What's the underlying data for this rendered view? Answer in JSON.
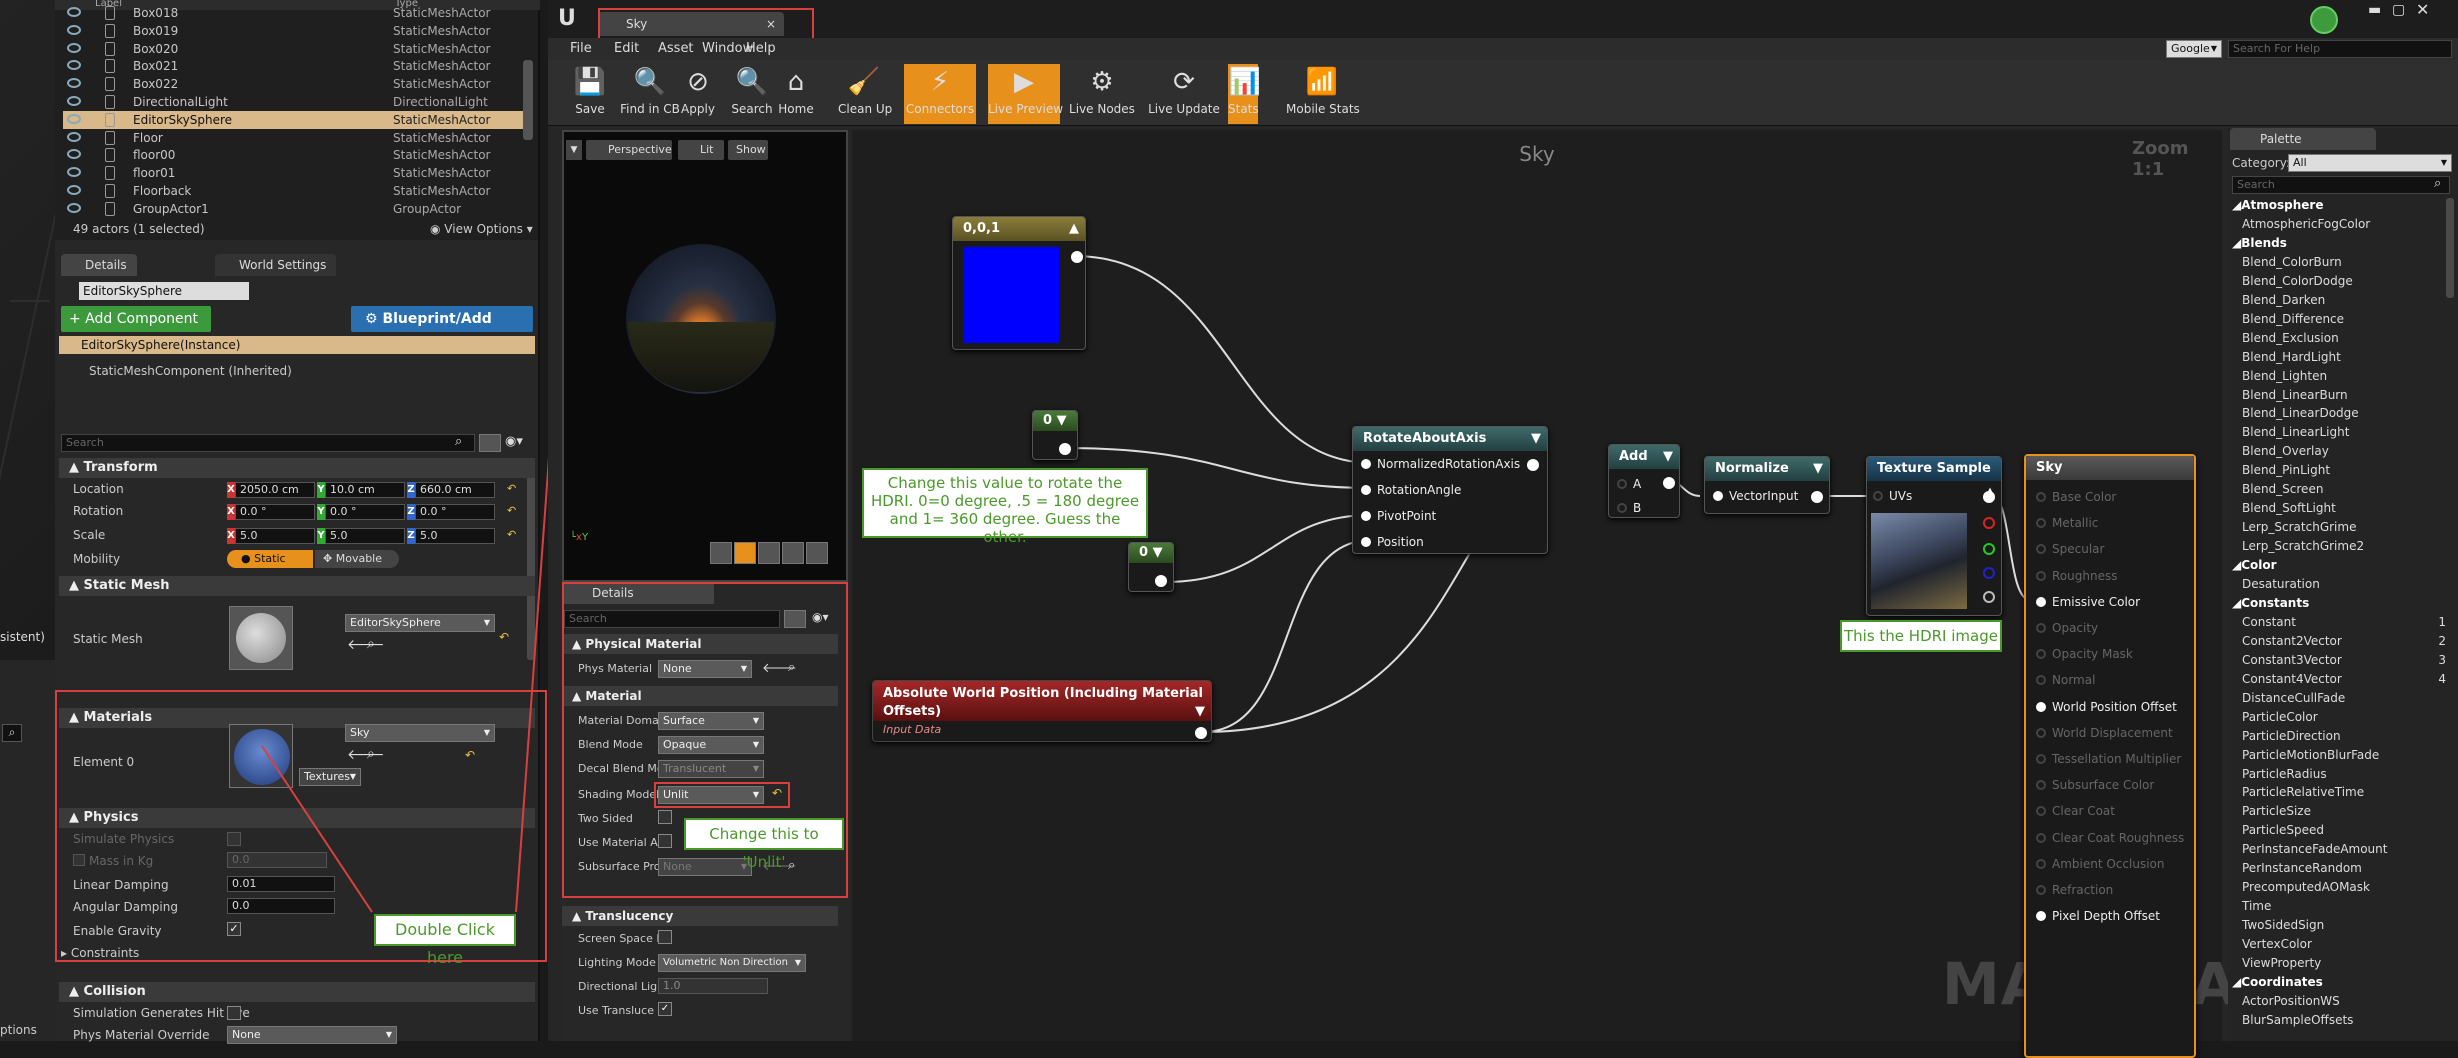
{
  "outliner": {
    "header": {
      "label": "Label",
      "type": "Type"
    },
    "rows": [
      {
        "name": "Box018",
        "type": "StaticMeshActor"
      },
      {
        "name": "Box019",
        "type": "StaticMeshActor"
      },
      {
        "name": "Box020",
        "type": "StaticMeshActor"
      },
      {
        "name": "Box021",
        "type": "StaticMeshActor"
      },
      {
        "name": "Box022",
        "type": "StaticMeshActor"
      },
      {
        "name": "DirectionalLight",
        "type": "DirectionalLight"
      },
      {
        "name": "EditorSkySphere",
        "type": "StaticMeshActor"
      },
      {
        "name": "Floor",
        "type": "StaticMeshActor"
      },
      {
        "name": "floor00",
        "type": "StaticMeshActor"
      },
      {
        "name": "floor01",
        "type": "StaticMeshActor"
      },
      {
        "name": "Floorback",
        "type": "StaticMeshActor"
      },
      {
        "name": "GroupActor1",
        "type": "GroupActor"
      }
    ],
    "status": "49 actors (1 selected)",
    "view_options": "View Options"
  },
  "details": {
    "tabs": [
      "Details",
      "World Settings"
    ],
    "actor_name": "EditorSkySphere",
    "add_component": "+ Add Component",
    "blueprint": "Blueprint/Add Script",
    "instance": "EditorSkySphere(Instance)",
    "component": "StaticMeshComponent (Inherited)",
    "search_placeholder": "Search",
    "transform": {
      "title": "Transform",
      "location_label": "Location",
      "rotation_label": "Rotation",
      "scale_label": "Scale",
      "mobility_label": "Mobility",
      "location": [
        "2050.0 cm",
        "10.0 cm",
        "660.0 cm"
      ],
      "rotation": [
        "0.0 °",
        "0.0 °",
        "0.0 °"
      ],
      "scale": [
        "5.0",
        "5.0",
        "5.0"
      ],
      "static": "Static",
      "movable": "Movable"
    },
    "static_mesh": {
      "title": "Static Mesh",
      "label": "Static Mesh",
      "value": "EditorSkySphere"
    },
    "materials": {
      "title": "Materials",
      "label": "Element 0",
      "value": "Sky",
      "textures": "Textures"
    },
    "physics": {
      "title": "Physics",
      "simulate": "Simulate Physics",
      "mass": "Mass in Kg",
      "mass_value": "0.0",
      "linear": "Linear Damping",
      "linear_value": "0.01",
      "angular": "Angular Damping",
      "angular_value": "0.0",
      "gravity": "Enable Gravity",
      "constraints": "Constraints"
    },
    "collision": {
      "title": "Collision",
      "sim_hit": "Simulation Generates Hit Eve",
      "phys_override": "Phys Material Override",
      "phys_value": "None"
    },
    "options": "ptions"
  },
  "annotations": {
    "double_click": "Double Click here",
    "unlit": "Change this to 'Unlit'",
    "rotate": "Change this value to rotate the HDRI. 0=0 degree, .5 = 180 degree and 1= 360 degree. Guess the other.",
    "hdri": "This the HDRI image"
  },
  "material_editor": {
    "tab": "Sky",
    "menu": [
      "File",
      "Edit",
      "Asset",
      "Window",
      "Help"
    ],
    "toolbar": [
      "Save",
      "Find in CB",
      "Apply",
      "Search",
      "Home",
      "Clean Up",
      "Connectors",
      "Live Preview",
      "Live Nodes",
      "Live Update",
      "Stats",
      "Mobile Stats"
    ],
    "search_engine": "Google",
    "search_help": "Search For Help",
    "preview": {
      "perspective": "Perspective",
      "lit": "Lit",
      "show": "Show"
    },
    "graph_title": "Sky",
    "zoom": "Zoom 1:1",
    "watermark": "MATERIAL",
    "mat_details": {
      "tab": "Details",
      "search": "Search",
      "phys_section": "Physical Material",
      "phys_label": "Phys Material",
      "phys_value": "None",
      "material_section": "Material",
      "domain_label": "Material Doma",
      "domain_value": "Surface",
      "blend_label": "Blend Mode",
      "blend_value": "Opaque",
      "decal_label": "Decal Blend Mo",
      "decal_value": "Translucent",
      "shading_label": "Shading Model",
      "shading_value": "Unlit",
      "two_sided": "Two Sided",
      "use_material": "Use Material A",
      "subsurface": "Subsurface Pro",
      "subsurface_value": "None",
      "translucency": "Translucency",
      "screen_space": "Screen Space R",
      "lighting_mode": "Lighting Mode",
      "lighting_value": "Volumetric Non Direction",
      "directional": "Directional Ligh",
      "directional_value": "1.0",
      "use_transluc": "Use Transluce"
    }
  },
  "nodes": {
    "const3": {
      "title": "0,0,1",
      "color": "#0000ff"
    },
    "zero1": {
      "title": "0"
    },
    "zero2": {
      "title": "0"
    },
    "rotate": {
      "title": "RotateAboutAxis",
      "pins": [
        "NormalizedRotationAxis",
        "RotationAngle",
        "PivotPoint",
        "Position"
      ]
    },
    "add": {
      "title": "Add",
      "pins": [
        "A",
        "B"
      ]
    },
    "normalize": {
      "title": "Normalize",
      "pins": [
        "VectorInput"
      ]
    },
    "texture": {
      "title": "Texture Sample",
      "pins": [
        "UVs"
      ]
    },
    "awp": {
      "title": "Absolute World Position (Including Material Offsets)",
      "subtitle": "Input Data"
    },
    "sky": {
      "title": "Sky",
      "pins": [
        {
          "label": "Base Color",
          "active": false
        },
        {
          "label": "Metallic",
          "active": false
        },
        {
          "label": "Specular",
          "active": false
        },
        {
          "label": "Roughness",
          "active": false
        },
        {
          "label": "Emissive Color",
          "active": true
        },
        {
          "label": "Opacity",
          "active": false
        },
        {
          "label": "Opacity Mask",
          "active": false
        },
        {
          "label": "Normal",
          "active": false
        },
        {
          "label": "World Position Offset",
          "active": true
        },
        {
          "label": "World Displacement",
          "active": false
        },
        {
          "label": "Tessellation Multiplier",
          "active": false
        },
        {
          "label": "Subsurface Color",
          "active": false
        },
        {
          "label": "Clear Coat",
          "active": false
        },
        {
          "label": "Clear Coat Roughness",
          "active": false
        },
        {
          "label": "Ambient Occlusion",
          "active": false
        },
        {
          "label": "Refraction",
          "active": false
        },
        {
          "label": "Pixel Depth Offset",
          "active": true
        }
      ]
    }
  },
  "palette": {
    "tab": "Palette",
    "category_label": "Category:",
    "category_value": "All",
    "search": "Search",
    "items": [
      {
        "t": "cat",
        "v": "Atmosphere"
      },
      {
        "t": "i",
        "v": "AtmosphericFogColor"
      },
      {
        "t": "cat",
        "v": "Blends"
      },
      {
        "t": "i",
        "v": "Blend_ColorBurn"
      },
      {
        "t": "i",
        "v": "Blend_ColorDodge"
      },
      {
        "t": "i",
        "v": "Blend_Darken"
      },
      {
        "t": "i",
        "v": "Blend_Difference"
      },
      {
        "t": "i",
        "v": "Blend_Exclusion"
      },
      {
        "t": "i",
        "v": "Blend_HardLight"
      },
      {
        "t": "i",
        "v": "Blend_Lighten"
      },
      {
        "t": "i",
        "v": "Blend_LinearBurn"
      },
      {
        "t": "i",
        "v": "Blend_LinearDodge"
      },
      {
        "t": "i",
        "v": "Blend_LinearLight"
      },
      {
        "t": "i",
        "v": "Blend_Overlay"
      },
      {
        "t": "i",
        "v": "Blend_PinLight"
      },
      {
        "t": "i",
        "v": "Blend_Screen"
      },
      {
        "t": "i",
        "v": "Blend_SoftLight"
      },
      {
        "t": "i",
        "v": "Lerp_ScratchGrime"
      },
      {
        "t": "i",
        "v": "Lerp_ScratchGrime2"
      },
      {
        "t": "cat",
        "v": "Color"
      },
      {
        "t": "i",
        "v": "Desaturation"
      },
      {
        "t": "cat",
        "v": "Constants"
      },
      {
        "t": "i",
        "v": "Constant",
        "n": "1"
      },
      {
        "t": "i",
        "v": "Constant2Vector",
        "n": "2"
      },
      {
        "t": "i",
        "v": "Constant3Vector",
        "n": "3"
      },
      {
        "t": "i",
        "v": "Constant4Vector",
        "n": "4"
      },
      {
        "t": "i",
        "v": "DistanceCullFade"
      },
      {
        "t": "i",
        "v": "ParticleColor"
      },
      {
        "t": "i",
        "v": "ParticleDirection"
      },
      {
        "t": "i",
        "v": "ParticleMotionBlurFade"
      },
      {
        "t": "i",
        "v": "ParticleRadius"
      },
      {
        "t": "i",
        "v": "ParticleRelativeTime"
      },
      {
        "t": "i",
        "v": "ParticleSize"
      },
      {
        "t": "i",
        "v": "ParticleSpeed"
      },
      {
        "t": "i",
        "v": "PerInstanceFadeAmount"
      },
      {
        "t": "i",
        "v": "PerInstanceRandom"
      },
      {
        "t": "i",
        "v": "PrecomputedAOMask"
      },
      {
        "t": "i",
        "v": "Time"
      },
      {
        "t": "i",
        "v": "TwoSidedSign"
      },
      {
        "t": "i",
        "v": "VertexColor"
      },
      {
        "t": "i",
        "v": "ViewProperty"
      },
      {
        "t": "cat",
        "v": "Coordinates"
      },
      {
        "t": "i",
        "v": "ActorPositionWS"
      },
      {
        "t": "i",
        "v": "BlurSampleOffsets"
      }
    ]
  },
  "left_strip": {
    "label": "sistent)"
  },
  "colors": {
    "accent": "#e8901c",
    "selected": "#d9b889",
    "annotation": "#4a9a2a",
    "callout": "#d84040"
  }
}
